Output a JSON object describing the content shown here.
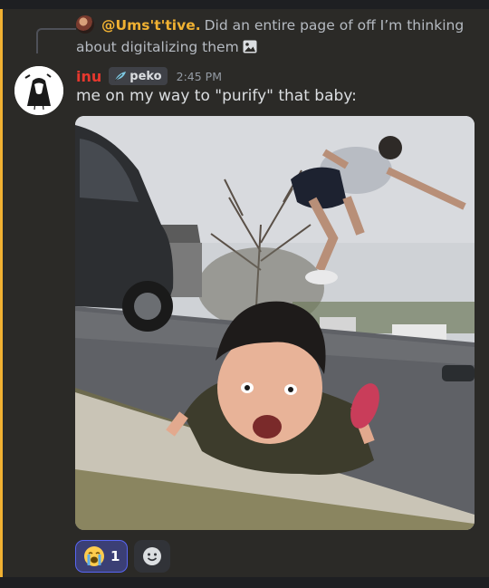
{
  "reply": {
    "author": "@Ums't'tive.",
    "text": "Did an entire page of off I’m thinking about digitalizing them",
    "attachment_icon": "image-icon"
  },
  "message": {
    "username": "inu",
    "tag": "peko",
    "tag_icon": "feather-icon",
    "timestamp": "2:45 PM",
    "content": "me on my way to \"purify\" that baby:"
  },
  "reactions": [
    {
      "emoji": "loudly-crying-face",
      "count": "1"
    }
  ],
  "add_reaction_icon": "add-reaction-icon",
  "colors": {
    "background": "#2b2a27",
    "username": "#e6382e",
    "reply_author": "#f0b132",
    "accent_bar": "#f0b132",
    "reaction_active": "#3b3f75",
    "reaction_border": "#5865f2"
  }
}
